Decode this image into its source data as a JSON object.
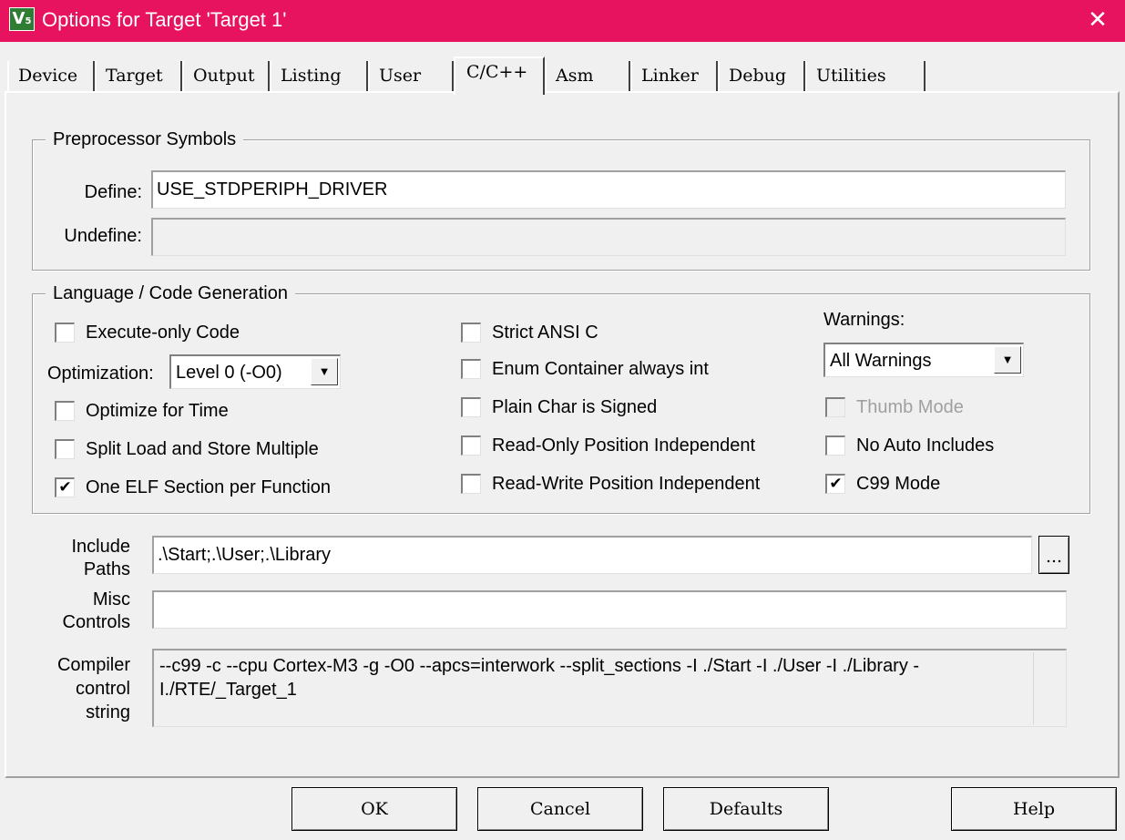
{
  "window": {
    "title": "Options for Target 'Target 1'",
    "close_glyph": "✕",
    "icon": "uvision-icon"
  },
  "tabs": [
    {
      "label": "Device"
    },
    {
      "label": "Target"
    },
    {
      "label": "Output"
    },
    {
      "label": "Listing"
    },
    {
      "label": "User"
    },
    {
      "label": "C/C++",
      "active": true
    },
    {
      "label": "Asm"
    },
    {
      "label": "Linker"
    },
    {
      "label": "Debug"
    },
    {
      "label": "Utilities"
    }
  ],
  "preprocessor": {
    "legend": "Preprocessor Symbols",
    "define_label": "Define:",
    "define_value": "USE_STDPERIPH_DRIVER",
    "undefine_label": "Undefine:",
    "undefine_value": ""
  },
  "language": {
    "legend": "Language / Code Generation",
    "execute_only": {
      "label": "Execute-only Code",
      "mark": ""
    },
    "optimization_label": "Optimization:",
    "optimization_value": "Level 0 (-O0)",
    "optimize_time": {
      "label": "Optimize for Time",
      "mark": ""
    },
    "split_load": {
      "label": "Split Load and Store Multiple",
      "mark": ""
    },
    "one_elf": {
      "label": "One ELF Section per Function",
      "mark": "✔"
    },
    "strict_ansi": {
      "label": "Strict ANSI C",
      "mark": ""
    },
    "enum_container": {
      "label": "Enum Container always int",
      "mark": ""
    },
    "plain_char": {
      "label": "Plain Char is Signed",
      "mark": ""
    },
    "ro_pi": {
      "label": "Read-Only Position Independent",
      "mark": ""
    },
    "rw_pi": {
      "label": "Read-Write Position Independent",
      "mark": ""
    },
    "warnings_label": "Warnings:",
    "warnings_value": "All Warnings",
    "thumb_mode": {
      "label": "Thumb Mode",
      "mark": ""
    },
    "no_auto_includes": {
      "label": "No Auto Includes",
      "mark": ""
    },
    "c99_mode": {
      "label": "C99 Mode",
      "mark": "✔"
    },
    "dropdown_glyph": "▼"
  },
  "include_paths": {
    "label_1": "Include",
    "label_2": "Paths",
    "value": ".\\Start;.\\User;.\\Library",
    "browse_label": "..."
  },
  "misc_controls": {
    "label_1": "Misc",
    "label_2": "Controls",
    "value": ""
  },
  "compiler_string": {
    "label_1": "Compiler",
    "label_2": "control",
    "label_3": "string",
    "value": "--c99 -c --cpu Cortex-M3 -g -O0 --apcs=interwork --split_sections -I ./Start -I ./User -I ./Library -I./RTE/_Target_1"
  },
  "buttons": {
    "ok": "OK",
    "cancel": "Cancel",
    "defaults": "Defaults",
    "help": "Help"
  },
  "colors": {
    "titlebar": "#e8135e",
    "dialog": "#f0f0f0"
  }
}
